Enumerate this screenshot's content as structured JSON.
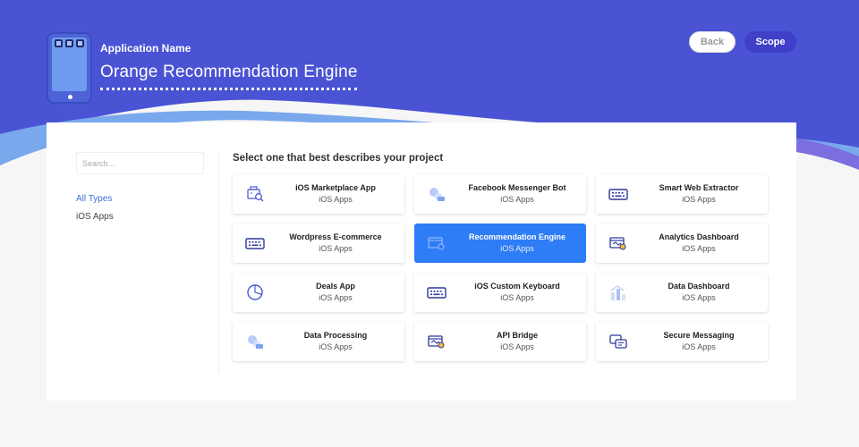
{
  "header": {
    "app_label": "Application Name",
    "app_name": "Orange Recommendation Engine",
    "back_label": "Back",
    "scope_label": "Scope"
  },
  "colors": {
    "hero": "#4a53d4",
    "accent": "#3f3fc8",
    "selected": "#2e7cf6",
    "link": "#3d6fd6"
  },
  "sidebar": {
    "search_placeholder": "Search...",
    "filters": [
      {
        "label": "All Types",
        "active": true
      },
      {
        "label": "iOS Apps",
        "active": false
      }
    ]
  },
  "main": {
    "heading": "Select one that best describes your project",
    "tiles": [
      {
        "title": "iOS Marketplace App",
        "sub": "iOS Apps",
        "icon": "marketplace-icon",
        "selected": false
      },
      {
        "title": "Facebook Messenger Bot",
        "sub": "iOS Apps",
        "icon": "bot-icon",
        "selected": false
      },
      {
        "title": "Smart Web Extractor",
        "sub": "iOS Apps",
        "icon": "keyboard-icon",
        "selected": false
      },
      {
        "title": "Wordpress E-commerce",
        "sub": "iOS Apps",
        "icon": "keyboard-icon",
        "selected": false
      },
      {
        "title": "Recommendation Engine",
        "sub": "iOS Apps",
        "icon": "engine-icon",
        "selected": true
      },
      {
        "title": "Analytics Dashboard",
        "sub": "iOS Apps",
        "icon": "dashboard-icon",
        "selected": false
      },
      {
        "title": "Deals App",
        "sub": "iOS Apps",
        "icon": "pie-icon",
        "selected": false
      },
      {
        "title": "iOS Custom Keyboard",
        "sub": "iOS Apps",
        "icon": "keyboard-icon",
        "selected": false
      },
      {
        "title": "Data Dashboard",
        "sub": "iOS Apps",
        "icon": "bar-chart-icon",
        "selected": false
      },
      {
        "title": "Data Processing",
        "sub": "iOS Apps",
        "icon": "bot-icon",
        "selected": false
      },
      {
        "title": "API Bridge",
        "sub": "iOS Apps",
        "icon": "dashboard-icon",
        "selected": false
      },
      {
        "title": "Secure Messaging",
        "sub": "iOS Apps",
        "icon": "chat-icon",
        "selected": false
      }
    ]
  }
}
